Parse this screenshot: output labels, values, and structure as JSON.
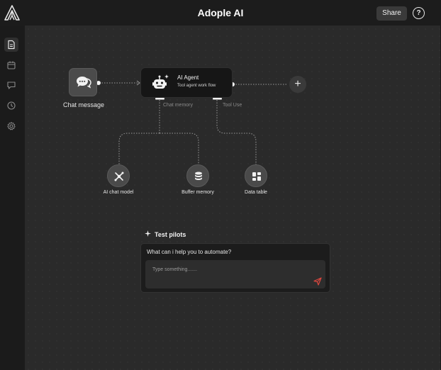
{
  "header": {
    "title": "Adople AI",
    "share_label": "Share",
    "help_label": "?",
    "logo_icon": "adople-logo-icon"
  },
  "sidebar": {
    "items": [
      {
        "icon": "document-icon",
        "active": true
      },
      {
        "icon": "calendar-icon",
        "active": false
      },
      {
        "icon": "chat-bubble-icon",
        "active": false
      },
      {
        "icon": "clock-icon",
        "active": false
      },
      {
        "icon": "gear-icon",
        "active": false
      }
    ]
  },
  "canvas": {
    "chat_node": {
      "label": "Chat message",
      "icon": "chat-bubbles-icon"
    },
    "agent_node": {
      "title": "AI Agent",
      "subtitle": "Tool agent work flow",
      "icon": "robot-icon",
      "ports": {
        "memory": "Chat memory",
        "tool": "Tool Use"
      }
    },
    "add_node": {
      "label": "+",
      "icon": "plus-icon"
    },
    "sub_nodes": [
      {
        "label": "AI chat model",
        "icon": "ai-model-icon"
      },
      {
        "label": "Buffer memory",
        "icon": "database-icon"
      },
      {
        "label": "Data table",
        "icon": "grid-icon"
      }
    ]
  },
  "test_pilots": {
    "title": "Test pilots",
    "question": "What can i help you to automate?",
    "placeholder": "Type something.......",
    "send_icon": "send-icon"
  },
  "colors": {
    "background": "#1b1b1b",
    "canvas": "#2a2a2a",
    "node": "#4b4b4b",
    "send_accent": "#d9473f"
  }
}
